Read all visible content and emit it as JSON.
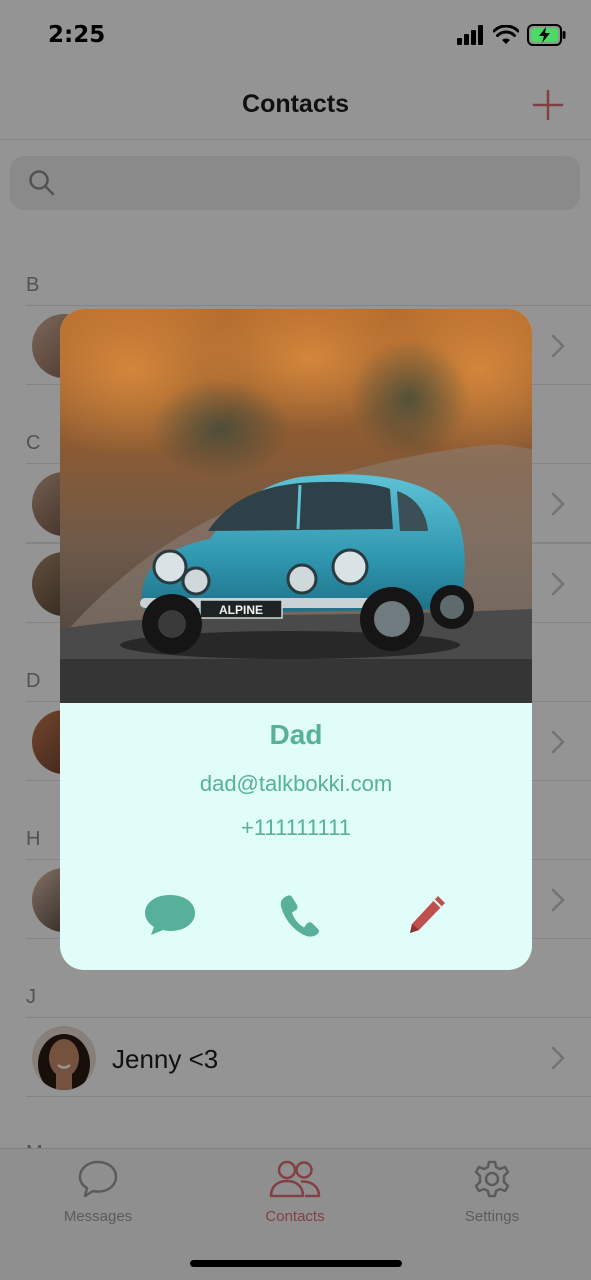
{
  "status_bar": {
    "time": "2:25"
  },
  "nav": {
    "title": "Contacts",
    "add_icon": "plus-icon"
  },
  "search": {
    "placeholder": "",
    "icon": "search-icon"
  },
  "sections": [
    {
      "letter": "B"
    },
    {
      "letter": "C"
    },
    {
      "letter": "D"
    },
    {
      "letter": "H"
    },
    {
      "letter": "J",
      "contacts": [
        {
          "name": "Jenny <3"
        }
      ]
    },
    {
      "letter": "M"
    }
  ],
  "tabs": [
    {
      "label": "Messages",
      "icon": "chat-bubble-icon",
      "active": false
    },
    {
      "label": "Contacts",
      "icon": "people-icon",
      "active": true
    },
    {
      "label": "Settings",
      "icon": "gear-icon",
      "active": false
    }
  ],
  "card": {
    "name": "Dad",
    "email": "dad@talkbokki.com",
    "phone": "+111111111",
    "plate_text": "ALPINE",
    "actions": [
      {
        "icon": "message-icon"
      },
      {
        "icon": "phone-icon"
      },
      {
        "icon": "edit-pencil-icon"
      }
    ]
  },
  "colors": {
    "accent": "#58b09a",
    "card_background": "#e0fdfa",
    "tab_active": "#e06f73",
    "edit_icon": "#c0504d",
    "overlay": "#000000"
  }
}
